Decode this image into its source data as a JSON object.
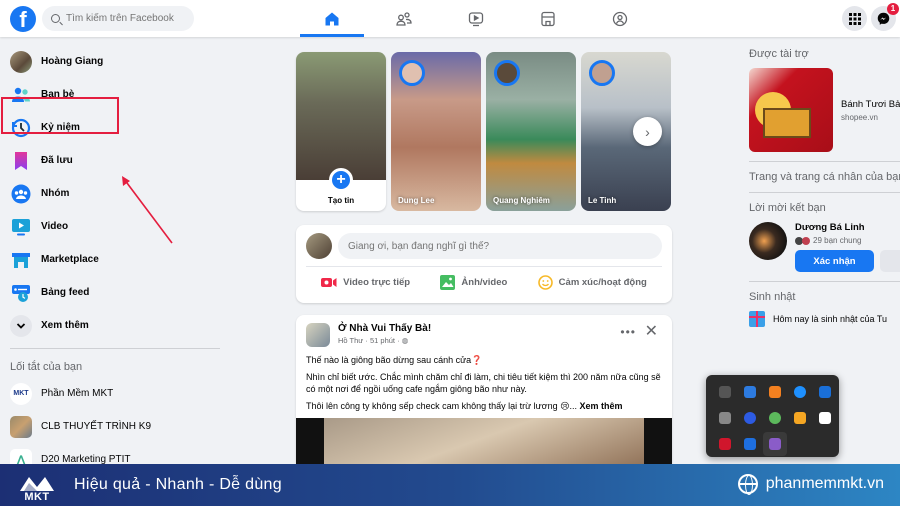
{
  "topbar": {
    "logo": "f",
    "search_placeholder": "Tìm kiếm trên Facebook",
    "nav_tabs": [
      {
        "name": "home",
        "icon": "home-icon",
        "active": true
      },
      {
        "name": "friends",
        "icon": "friends-icon",
        "active": false
      },
      {
        "name": "watch",
        "icon": "video-icon",
        "active": false
      },
      {
        "name": "marketplace",
        "icon": "store-icon",
        "active": false
      },
      {
        "name": "groups",
        "icon": "groups-icon",
        "active": false
      }
    ],
    "messenger_badge": "1"
  },
  "sidebar": {
    "items": [
      {
        "label": "Hoàng Giang",
        "icon": "avatar"
      },
      {
        "label": "Bạn bè",
        "icon": "friends-icon"
      },
      {
        "label": "Kỷ niệm",
        "icon": "memories-clock-icon"
      },
      {
        "label": "Đã lưu",
        "icon": "bookmark-icon",
        "highlighted": true
      },
      {
        "label": "Nhóm",
        "icon": "groups-icon"
      },
      {
        "label": "Video",
        "icon": "video-icon"
      },
      {
        "label": "Marketplace",
        "icon": "store-icon"
      },
      {
        "label": "Bảng feed",
        "icon": "feed-icon"
      },
      {
        "label": "Xem thêm",
        "icon": "chevron-down-icon"
      }
    ],
    "shortcuts_title": "Lối tắt của bạn",
    "shortcuts": [
      {
        "label": "Phần Mềm MKT"
      },
      {
        "label": "CLB THUYẾT TRÌNH K9"
      },
      {
        "label": "D20 Marketing PTIT"
      }
    ]
  },
  "stories": {
    "create_label": "Tạo tin",
    "items": [
      {
        "name": "Dung Lee"
      },
      {
        "name": "Quang Nghiêm"
      },
      {
        "name": "Le Tinh"
      }
    ]
  },
  "composer": {
    "placeholder": "Giang ơi, bạn đang nghĩ gì thế?",
    "actions": [
      {
        "label": "Video trực tiếp",
        "icon": "live-video-icon",
        "color": "#f02849"
      },
      {
        "label": "Ảnh/video",
        "icon": "photo-icon",
        "color": "#45bd62"
      },
      {
        "label": "Cảm xúc/hoạt động",
        "icon": "emoji-icon",
        "color": "#f7b928"
      }
    ]
  },
  "post": {
    "page": "Ở Nhà Vui Thấy Bà!",
    "author": "Hồ Thư",
    "time": "51 phút",
    "line1": "Thế nào là giông bão dừng sau cánh cửa❓",
    "line2": "Nhìn chỉ biết ước. Chắc mình chăm chỉ đi làm, chi tiêu tiết kiệm thì 200 năm nữa cũng sẽ có một nơi để ngồi uống cafe ngắm giông bão như này.",
    "line3": "Thôi lên công ty không sếp check cam không thấy lại trừ lương 😢...",
    "see_more": "Xem thêm"
  },
  "right": {
    "sponsored_title": "Được tài trợ",
    "ad_title": "Bánh Tươi Bảo Ngọc",
    "ad_domain": "shopee.vn",
    "pages_title": "Trang và trang cá nhân của bạn",
    "friend_requests_title": "Lời mời kết bạn",
    "request_name": "Dương Bá Linh",
    "mutual_friends": "29 bạn chung",
    "confirm_label": "Xác nhận",
    "birthday_title": "Sinh nhật",
    "birthday_text": "Hôm nay là sinh nhật của Tu"
  },
  "tray_icons": [
    {
      "name": "skype-icon",
      "color": "#555555"
    },
    {
      "name": "calendar-app-icon",
      "color": "#2d7be0"
    },
    {
      "name": "cloudflare-icon",
      "color": "#f38020"
    },
    {
      "name": "app-round-icon",
      "color": "#1e90ff"
    },
    {
      "name": "defender-icon",
      "color": "#1a6fd8"
    },
    {
      "name": "cloud-offline-icon",
      "color": "#888888"
    },
    {
      "name": "zoom-app-icon",
      "color": "#2d5be3"
    },
    {
      "name": "utorrent-icon",
      "color": "#5cb85c"
    },
    {
      "name": "vpn-arrow-icon",
      "color": "#f5a623"
    },
    {
      "name": "teamviewer-icon",
      "color": "#ffffff"
    },
    {
      "name": "app-red-icon",
      "color": "#d0162c"
    },
    {
      "name": "bluetooth-icon",
      "color": "#1e6fe0"
    },
    {
      "name": "pen-feather-icon",
      "color": "#8a5cc8"
    }
  ],
  "banner": {
    "logo_text": "MKT",
    "slogan": "Hiệu quả - Nhanh - Dễ dùng",
    "website": "phanmemmkt.vn"
  }
}
